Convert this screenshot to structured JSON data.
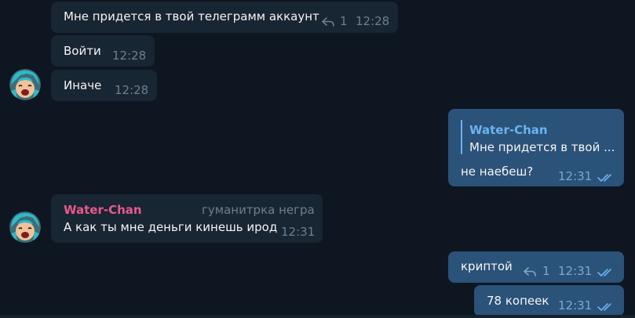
{
  "messages": [
    {
      "text": "Мне придется в твой телеграмм аккаунт",
      "time": "12:28",
      "replies": "1"
    },
    {
      "text": "Войти",
      "time": "12:28"
    },
    {
      "text": "Иначе",
      "time": "12:28"
    },
    {
      "reply_name": "Water-Chan",
      "reply_text": "Мне придется в твой ...",
      "text": "не наебеш?",
      "time": "12:31"
    },
    {
      "name": "Water-Chan",
      "badge": "гуманитрка негра",
      "text": "А как ты мне деньги кинешь ирод",
      "time": "12:31"
    },
    {
      "text": "криптой",
      "time": "12:31",
      "replies": "1"
    },
    {
      "text": "78 копеек",
      "time": "12:31"
    }
  ],
  "colors": {
    "background": "#0e1621",
    "incoming_bubble": "#182533",
    "outgoing_bubble": "#2b5278",
    "sender_name": "#e85a8c",
    "reply_accent": "#6ab3f3"
  },
  "icons": {
    "reply": "reply-arrow-icon",
    "read": "double-check-icon",
    "avatar": "anime-girl-avatar"
  }
}
